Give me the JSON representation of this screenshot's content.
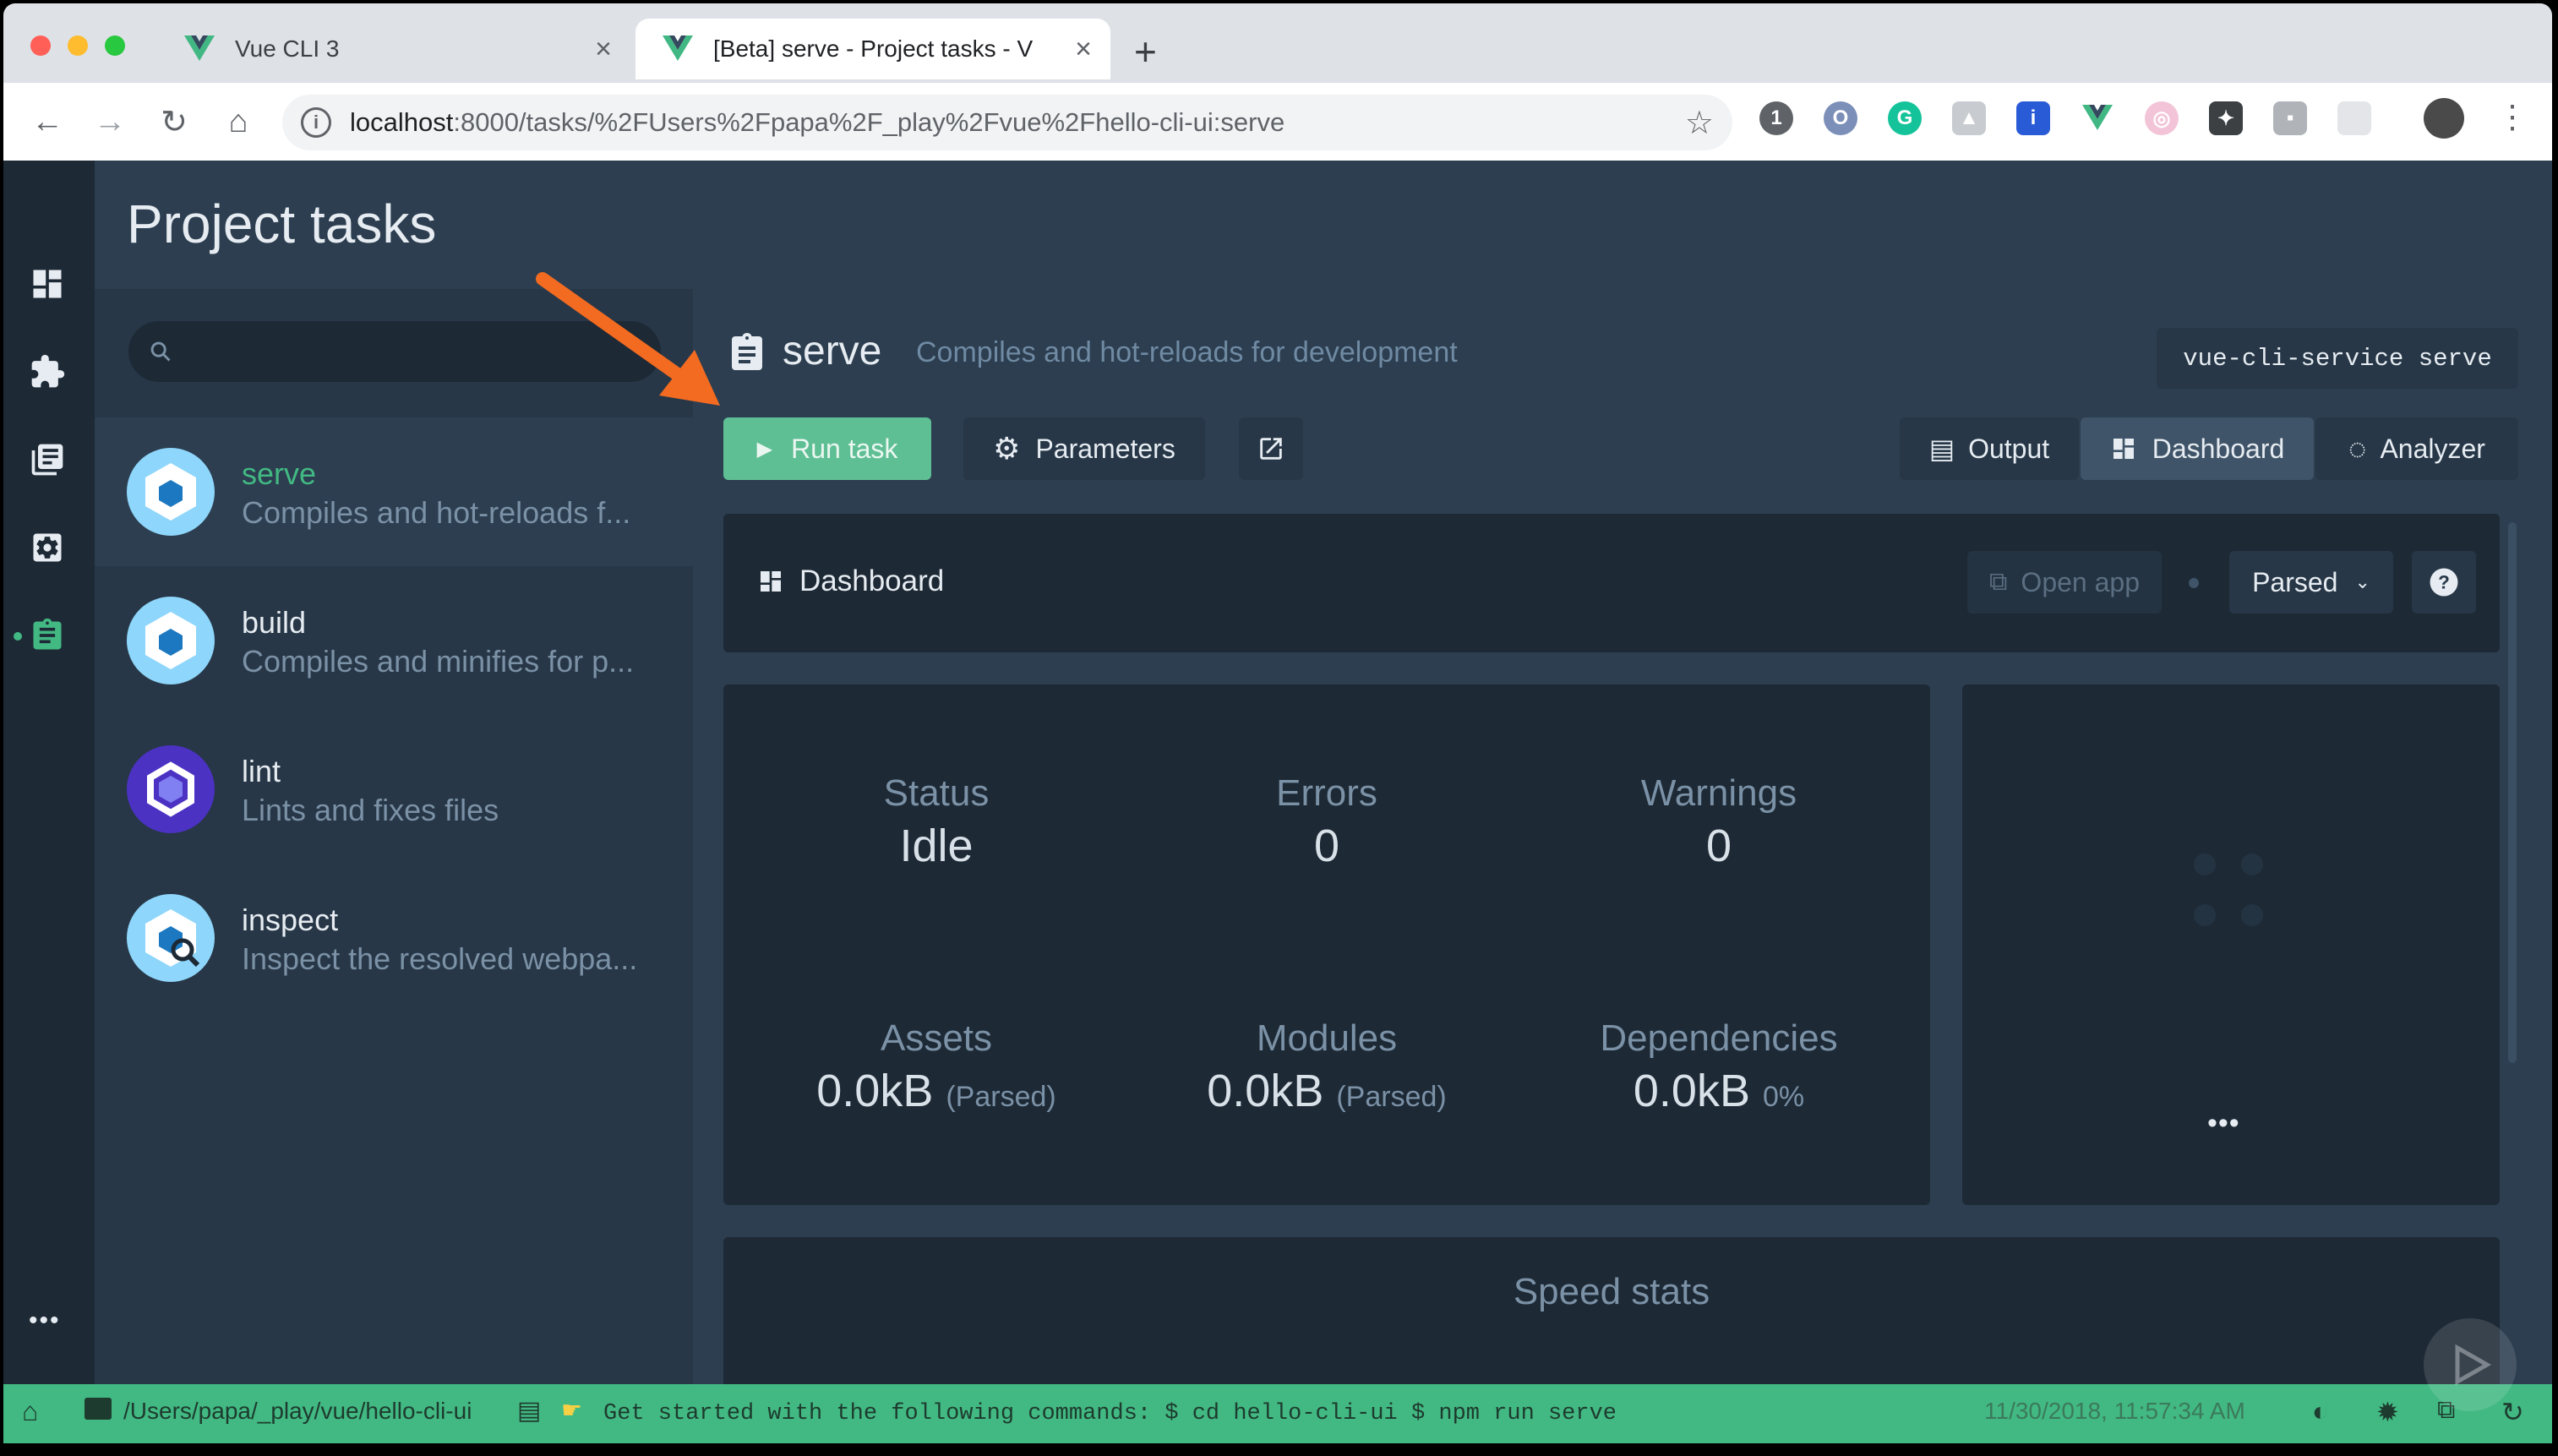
{
  "browser": {
    "tabs": [
      {
        "title": "Vue CLI 3",
        "active": false
      },
      {
        "title": "[Beta] serve - Project tasks - V",
        "active": true
      }
    ],
    "new_tab": "+",
    "url_host": "localhost",
    "url_path": ":8000/tasks/%2FUsers%2Fpapa%2F_play%2Fvue%2Fhello-cli-ui:serve",
    "extensions": [
      "1password-icon",
      "opera-icon",
      "grammarly-icon",
      "ext-icon",
      "bookmark-icon",
      "vue-devtools-icon",
      "color-icon",
      "puzzle-icon",
      "chat-icon",
      "grid-icon"
    ]
  },
  "app": {
    "page_title": "Project tasks",
    "search": {
      "placeholder": ""
    },
    "nav_rail": [
      "dashboard-icon",
      "plugins-icon",
      "dependencies-icon",
      "configuration-icon",
      "tasks-icon"
    ],
    "more": "•••",
    "tasks": [
      {
        "name": "serve",
        "description": "Compiles and hot-reloads f...",
        "selected": true
      },
      {
        "name": "build",
        "description": "Compiles and minifies for p...",
        "selected": false
      },
      {
        "name": "lint",
        "description": "Lints and fixes files",
        "selected": false
      },
      {
        "name": "inspect",
        "description": "Inspect the resolved webpa...",
        "selected": false
      }
    ],
    "task_detail": {
      "name": "serve",
      "description": "Compiles and hot-reloads for development",
      "command": "vue-cli-service serve",
      "run_label": "Run task",
      "parameters_label": "Parameters",
      "view_tabs": {
        "output": "Output",
        "dashboard": "Dashboard",
        "analyzer": "Analyzer"
      },
      "dashboard": {
        "title": "Dashboard",
        "open_app": "Open app",
        "mode": "Parsed",
        "stats": {
          "status": {
            "label": "Status",
            "value": "Idle"
          },
          "errors": {
            "label": "Errors",
            "value": "0"
          },
          "warnings": {
            "label": "Warnings",
            "value": "0"
          },
          "assets": {
            "label": "Assets",
            "value": "0.0kB",
            "sub": "(Parsed)"
          },
          "modules": {
            "label": "Modules",
            "value": "0.0kB",
            "sub": "(Parsed)"
          },
          "dependencies": {
            "label": "Dependencies",
            "value": "0.0kB",
            "sub": "0%"
          }
        },
        "side_more": "•••",
        "speed_stats": "Speed stats"
      }
    }
  },
  "status_bar": {
    "path": "/Users/papa/_play/vue/hello-cli-ui",
    "log": "Get started with the following commands: $ cd hello-cli-ui $ npm run serve",
    "timestamp": "11/30/2018, 11:57:34 AM"
  },
  "colors": {
    "accent": "#42b983",
    "arrow": "#f26b21",
    "bg": "#2c3e50",
    "panel": "#1d2935"
  }
}
